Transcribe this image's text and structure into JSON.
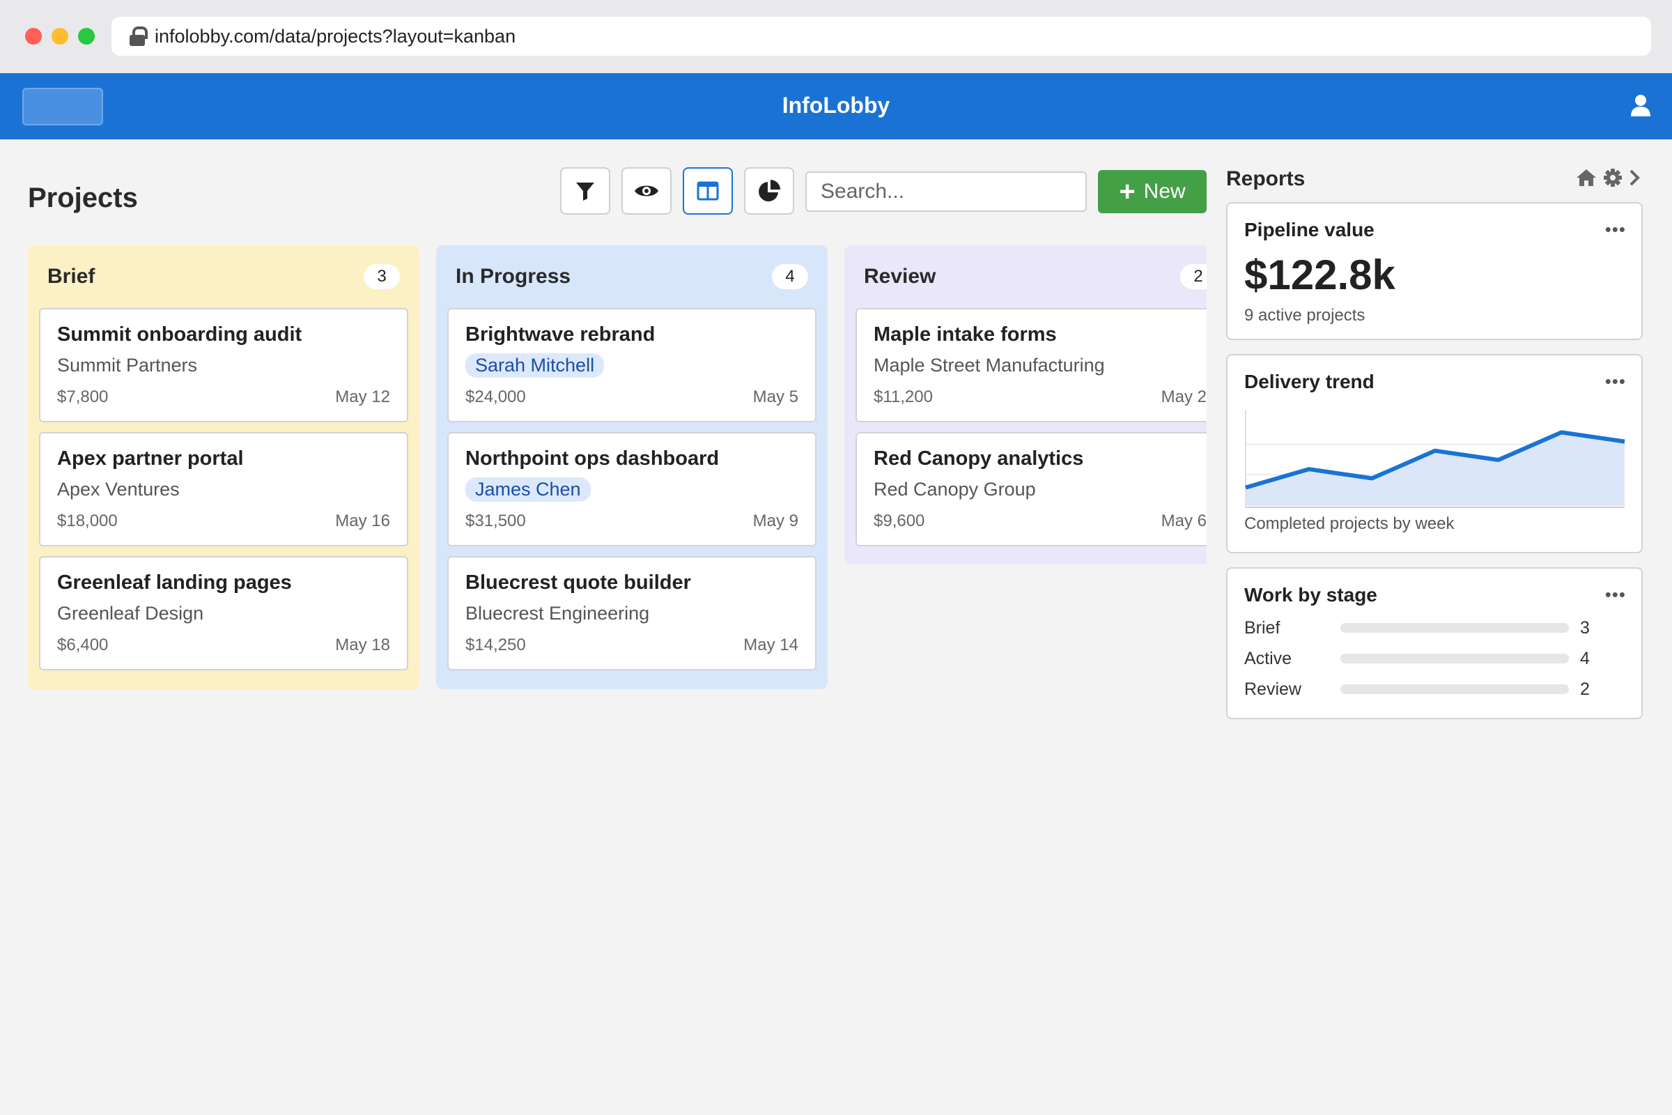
{
  "browser": {
    "url": "infolobby.com/data/projects?layout=kanban"
  },
  "app": {
    "title": "InfoLobby"
  },
  "page": {
    "title": "Projects",
    "search_placeholder": "Search...",
    "new_label": "New",
    "toolbar_icons": [
      "filter-icon",
      "eye-icon",
      "kanban-layout-icon",
      "pie-chart-icon"
    ],
    "active_view": "kanban-layout-icon"
  },
  "board": {
    "columns": [
      {
        "title": "Brief",
        "count": "3",
        "cards": [
          {
            "title": "Summit onboarding audit",
            "client": "Summit Partners",
            "amount": "$7,800",
            "date": "May 12"
          },
          {
            "title": "Apex partner portal",
            "client": "Apex Ventures",
            "amount": "$18,000",
            "date": "May 16"
          },
          {
            "title": "Greenleaf landing pages",
            "client": "Greenleaf Design",
            "amount": "$6,400",
            "date": "May 18"
          }
        ]
      },
      {
        "title": "In Progress",
        "count": "4",
        "cards": [
          {
            "title": "Brightwave rebrand",
            "assignee": "Sarah Mitchell",
            "amount": "$24,000",
            "date": "May 5"
          },
          {
            "title": "Northpoint ops dashboard",
            "assignee": "James Chen",
            "amount": "$31,500",
            "date": "May 9"
          },
          {
            "title": "Bluecrest quote builder",
            "client": "Bluecrest Engineering",
            "amount": "$14,250",
            "date": "May 14"
          }
        ]
      },
      {
        "title": "Review",
        "count": "2",
        "cards": [
          {
            "title": "Maple intake forms",
            "client": "Maple Street Manufacturing",
            "amount": "$11,200",
            "date": "May 2"
          },
          {
            "title": "Red Canopy analytics",
            "client": "Red Canopy Group",
            "amount": "$9,600",
            "date": "May 6"
          }
        ]
      }
    ]
  },
  "reports": {
    "title": "Reports",
    "pipeline": {
      "title": "Pipeline value",
      "value": "$122.8k",
      "subtitle": "9 active projects"
    },
    "trend": {
      "title": "Delivery trend",
      "subtitle": "Completed projects by week"
    },
    "stages": {
      "title": "Work by stage",
      "rows": [
        {
          "label": "Brief",
          "count": "3"
        },
        {
          "label": "Active",
          "count": "4"
        },
        {
          "label": "Review",
          "count": "2"
        }
      ]
    }
  },
  "colors": {
    "brand": "#1a73d4",
    "new_button": "#43a047",
    "brief_column": "#fcf0c5",
    "progress_column": "#d8e6fb",
    "review_column": "#ebe7fb"
  },
  "chart_data": {
    "type": "area",
    "title": "Delivery trend",
    "subtitle": "Completed projects by week",
    "x": [
      1,
      2,
      3,
      4,
      5,
      6,
      7
    ],
    "series": [
      {
        "values": [
          2,
          4,
          3,
          6,
          5,
          8,
          7
        ]
      }
    ],
    "grid": true,
    "ylim": [
      0,
      10
    ]
  }
}
